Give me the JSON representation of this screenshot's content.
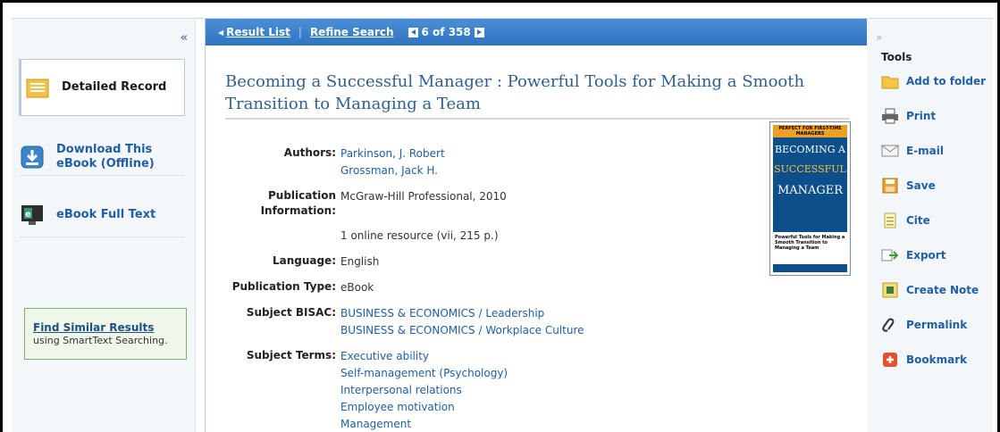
{
  "left_nav": {
    "collapse": "«",
    "items": [
      {
        "label": "Detailed Record",
        "icon": "detailed-record-icon"
      },
      {
        "label": "Download This eBook (Offline)",
        "icon": "download-ebook-icon"
      },
      {
        "label": "eBook Full Text",
        "icon": "ebook-full-text-icon"
      }
    ],
    "similar": {
      "link": "Find Similar Results",
      "text": "using SmartText Searching."
    }
  },
  "toolbar": {
    "result_list": "Result List",
    "refine_search": "Refine Search",
    "position": "6 of 358"
  },
  "record": {
    "title": "Becoming a Successful Manager : Powerful Tools for Making a Smooth Transition to Managing a Team",
    "fields": {
      "authors_label": "Authors:",
      "authors": [
        "Parkinson, J. Robert",
        "Grossman, Jack H."
      ],
      "pub_label": "Publication Information:",
      "pub_value": "McGraw-Hill Professional, 2010",
      "extent": "1 online resource (vii, 215 p.)",
      "language_label": "Language:",
      "language": "English",
      "ptype_label": "Publication Type:",
      "ptype": "eBook",
      "bisac_label": "Subject BISAC:",
      "bisac": [
        "BUSINESS & ECONOMICS / Leadership",
        "BUSINESS & ECONOMICS / Workplace Culture"
      ],
      "terms_label": "Subject Terms:",
      "terms": [
        "Executive ability",
        "Self-management (Psychology)",
        "Interpersonal relations",
        "Employee motivation",
        "Management"
      ]
    },
    "cover": {
      "banner": "PERFECT FOR FIRST-TIME MANAGERS",
      "line1": "BECOMING A",
      "line2": "SUCCESSFUL",
      "line3": "MANAGER",
      "subtitle": "Powerful Tools for Making a Smooth Transition to Managing a Team"
    }
  },
  "tools": {
    "collapse": "»",
    "heading": "Tools",
    "items": [
      {
        "label": "Add to folder",
        "icon": "folder-icon"
      },
      {
        "label": "Print",
        "icon": "printer-icon"
      },
      {
        "label": "E-mail",
        "icon": "email-icon"
      },
      {
        "label": "Save",
        "icon": "save-icon"
      },
      {
        "label": "Cite",
        "icon": "cite-icon"
      },
      {
        "label": "Export",
        "icon": "export-icon"
      },
      {
        "label": "Create Note",
        "icon": "note-icon"
      },
      {
        "label": "Permalink",
        "icon": "link-icon"
      },
      {
        "label": "Bookmark",
        "icon": "bookmark-icon"
      }
    ]
  }
}
